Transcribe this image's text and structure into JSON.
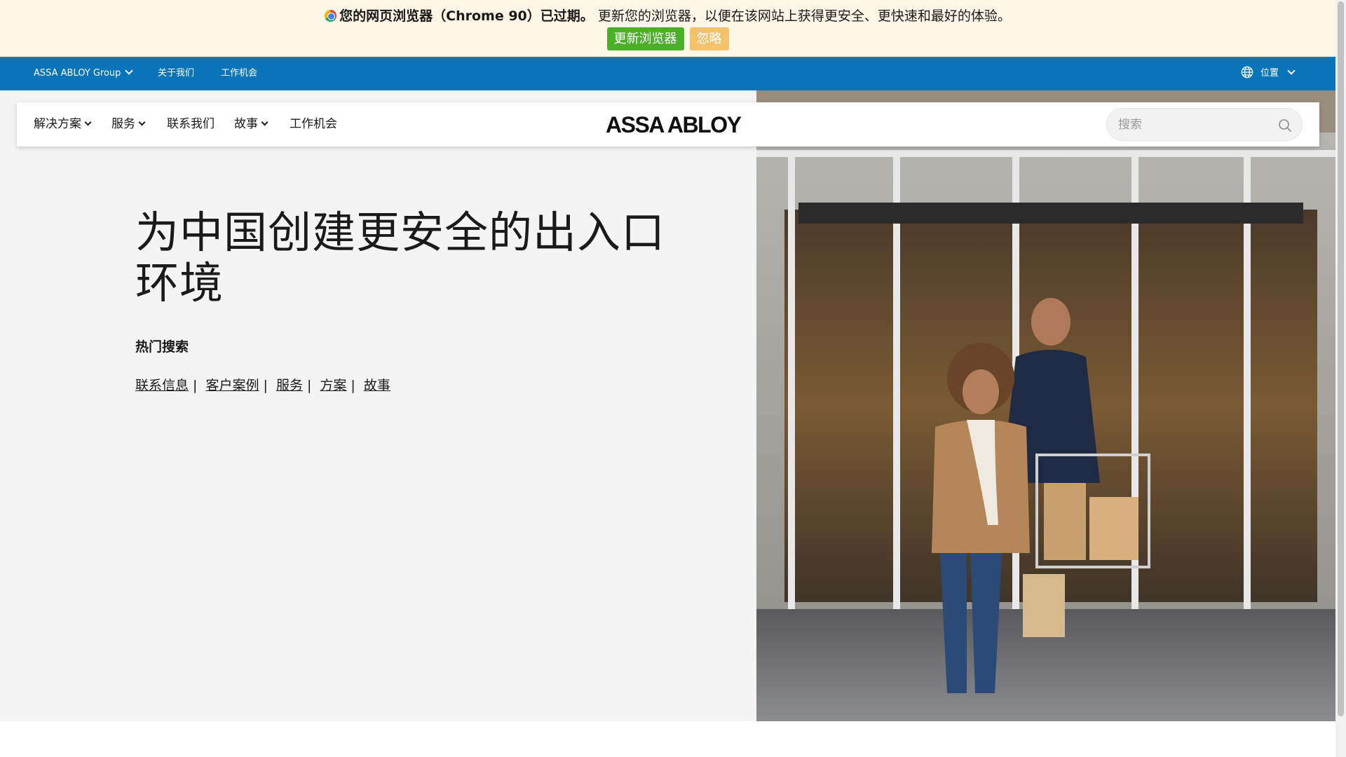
{
  "banner": {
    "bold_text": "您的网页浏览器（Chrome 90）已过期。",
    "text": "更新您的浏览器，以便在该网站上获得更安全、更快速和最好的体验。",
    "update_label": "更新浏览器",
    "ignore_label": "忽略",
    "icon": "chrome-icon",
    "colors": {
      "background": "#fdf5e6",
      "update": "#4caf2a",
      "ignore": "#f3c16b"
    }
  },
  "utility": {
    "color": "#0a74b8",
    "group_label": "ASSA ABLOY Group",
    "about_label": "关于我们",
    "careers_label": "工作机会",
    "location_label": "位置",
    "location_icon": "globe-icon"
  },
  "nav": {
    "items": [
      {
        "label": "解决方案",
        "dropdown": true
      },
      {
        "label": "服务",
        "dropdown": true
      },
      {
        "label": "联系我们",
        "dropdown": false
      },
      {
        "label": "故事",
        "dropdown": true
      },
      {
        "label": "工作机会",
        "dropdown": false
      }
    ],
    "logo": "ASSA ABLOY",
    "search_placeholder": "搜索",
    "search_icon": "search-icon"
  },
  "hero": {
    "title_line1": "为中国创建更安全的出入口",
    "title_line2": "环境",
    "popular_heading": "热门搜索",
    "links": [
      "联系信息",
      "客户案例",
      "服务",
      "方案",
      "故事"
    ]
  }
}
